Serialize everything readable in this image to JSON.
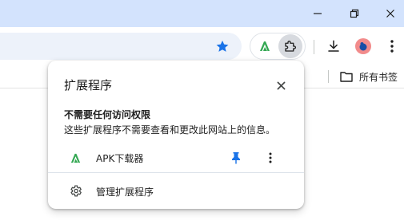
{
  "colors": {
    "titlebar_bg": "#d3e3fd",
    "omnibox_bg": "#edf2fa",
    "accent_blue": "#1a73e8",
    "apk_green": "#34a853",
    "avatar_bg": "#f28b8b"
  },
  "window_controls": {
    "minimize_icon": "minimize-icon",
    "restore_icon": "restore-icon",
    "close_icon": "close-icon"
  },
  "toolbar": {
    "bookmark_star_icon": "star-icon",
    "pinned_extension_icon": "apk-downloader-icon",
    "extensions_icon": "puzzle-icon",
    "download_icon": "download-icon",
    "profile_icon": "avatar",
    "menu_icon": "more-vert-icon"
  },
  "bookmarks_bar": {
    "all_bookmarks_label": "所有书签",
    "folder_icon": "folder-icon"
  },
  "extensions_popup": {
    "title": "扩展程序",
    "close_icon": "close-icon",
    "section_heading": "不需要任何访问权限",
    "section_description": "这些扩展程序不需要查看和更改此网站上的信息。",
    "extensions": [
      {
        "name": "APK下载器",
        "icon": "apk-downloader-icon",
        "pinned": true
      }
    ],
    "manage_label": "管理扩展程序",
    "manage_icon": "gear-icon"
  }
}
